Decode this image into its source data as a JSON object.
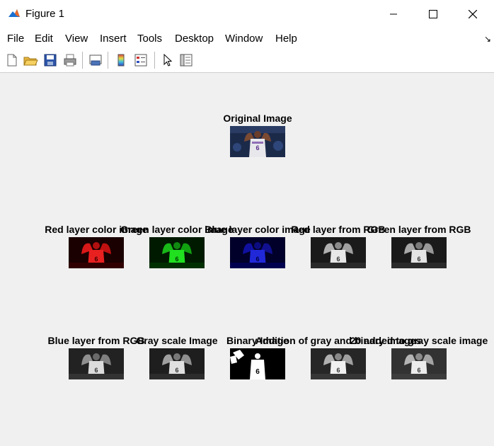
{
  "window": {
    "title": "Figure 1",
    "controls": [
      "minimize",
      "maximize",
      "close"
    ]
  },
  "menu": {
    "items": [
      "File",
      "Edit",
      "View",
      "Insert",
      "Tools",
      "Desktop",
      "Window",
      "Help"
    ]
  },
  "toolbar": {
    "icons": [
      "new-figure-icon",
      "open-folder-icon",
      "save-icon",
      "print-icon",
      "link-plot-icon",
      "colorbar-icon",
      "legend-icon",
      "pointer-icon",
      "property-inspector-icon"
    ]
  },
  "figure": {
    "original": {
      "title": "Original Image"
    },
    "row1": [
      {
        "title": "Red layer color image",
        "tint": "#d01010",
        "mode": "red"
      },
      {
        "title": "Green layer color image",
        "tint": "#10c010",
        "mode": "green"
      },
      {
        "title": "Blue layer color image",
        "tint": "#1020e0",
        "mode": "blue"
      },
      {
        "title": "Red layer from RGB",
        "tint": "#888888",
        "mode": "gray"
      },
      {
        "title": "Green layer from RGB",
        "tint": "#888888",
        "mode": "gray"
      }
    ],
    "row2": [
      {
        "title": "Blue layer from RGB",
        "tint": "#888888",
        "mode": "gray"
      },
      {
        "title": "Gray scale Image",
        "tint": "#888888",
        "mode": "gray"
      },
      {
        "title": "Binary Image",
        "tint": "#ffffff",
        "mode": "binary"
      },
      {
        "title": "Addition of gray and binary images",
        "tint": "#888888",
        "mode": "gray"
      },
      {
        "title": "20 added to gray scale image",
        "tint": "#888888",
        "mode": "gray"
      }
    ]
  }
}
